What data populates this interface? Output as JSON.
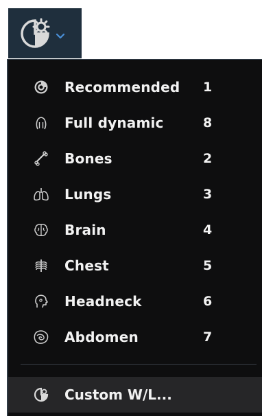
{
  "toolbar": {
    "button_icon": "window-level-icon",
    "dropdown_icon": "chevron-down-icon",
    "accent_color": "#4a90d9"
  },
  "menu": {
    "items": [
      {
        "label": "Recommended",
        "shortcut": "1",
        "icon": "recommended-icon"
      },
      {
        "label": "Full dynamic",
        "shortcut": "8",
        "icon": "full-dynamic-icon"
      },
      {
        "label": "Bones",
        "shortcut": "2",
        "icon": "bone-icon"
      },
      {
        "label": "Lungs",
        "shortcut": "3",
        "icon": "lungs-icon"
      },
      {
        "label": "Brain",
        "shortcut": "4",
        "icon": "brain-icon"
      },
      {
        "label": "Chest",
        "shortcut": "5",
        "icon": "chest-icon"
      },
      {
        "label": "Headneck",
        "shortcut": "6",
        "icon": "headneck-icon"
      },
      {
        "label": "Abdomen",
        "shortcut": "7",
        "icon": "abdomen-icon"
      }
    ],
    "custom": {
      "label": "Custom W/L...",
      "icon": "custom-wl-icon"
    }
  },
  "colors": {
    "toolbar_bg": "#1f2f3d",
    "menu_bg": "#0e0e0f",
    "highlight_bg": "#262628",
    "text": "#f2f2f2"
  }
}
